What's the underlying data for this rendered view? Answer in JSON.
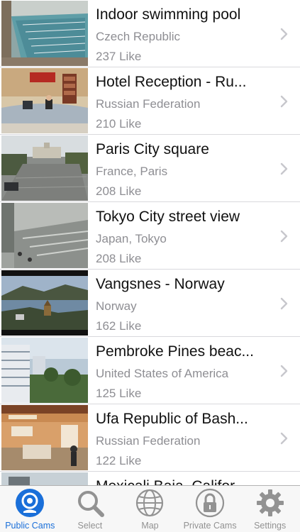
{
  "cams": [
    {
      "title": "Indoor swimming pool",
      "subtitle": "Czech Republic",
      "likes": "237 Like"
    },
    {
      "title": "Hotel Reception - Ru...",
      "subtitle": "Russian Federation",
      "likes": "210 Like"
    },
    {
      "title": "Paris City square",
      "subtitle": "France, Paris",
      "likes": "208 Like"
    },
    {
      "title": "Tokyo City street view",
      "subtitle": "Japan, Tokyo",
      "likes": "208 Like"
    },
    {
      "title": "Vangsnes - Norway",
      "subtitle": "Norway",
      "likes": "162 Like"
    },
    {
      "title": "Pembroke Pines beac...",
      "subtitle": "United States of America",
      "likes": "125 Like"
    },
    {
      "title": "Ufa Republic of Bash...",
      "subtitle": "Russian Federation",
      "likes": "122 Like"
    },
    {
      "title": "Mexicali Baja, Califor...",
      "subtitle": "",
      "likes": ""
    }
  ],
  "tabs": [
    {
      "label": "Public Cams",
      "icon": "webcam-icon",
      "active": true
    },
    {
      "label": "Select",
      "icon": "search-icon",
      "active": false
    },
    {
      "label": "Map",
      "icon": "globe-icon",
      "active": false
    },
    {
      "label": "Private Cams",
      "icon": "lock-icon",
      "active": false
    },
    {
      "label": "Settings",
      "icon": "gear-icon",
      "active": false
    }
  ],
  "colors": {
    "accent": "#1a6fd9",
    "inactive": "#929292",
    "secondary_text": "#8e8e93"
  }
}
